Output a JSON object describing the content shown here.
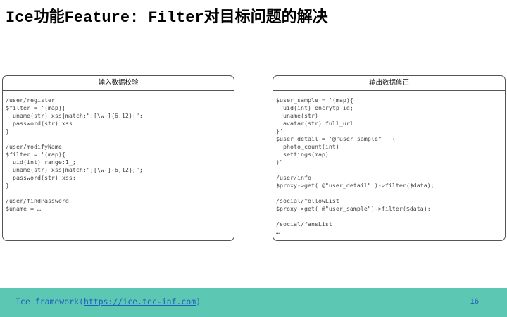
{
  "slide": {
    "title": "Ice功能Feature: Filter对目标问题的解决"
  },
  "left_panel": {
    "header": "输入数据校验",
    "lines": [
      "/user/register",
      "$filter = '(map){",
      "  uname(str) xss|match:\";[\\w-]{6,12};\";",
      "  password(str) xss",
      "}'",
      "",
      "/user/modifyName",
      "$filter = '(map){",
      "  uid(int) range:1_;",
      "  uname(str) xss|match:\";[\\w-]{6,12};\";",
      "  password(str) xss;",
      "}'",
      "",
      "/user/findPassword",
      "$uname = …"
    ]
  },
  "right_panel": {
    "header": "输出数据修正",
    "lines": [
      "$user_sample = '(map){",
      "  uid(int) encrytp_id;",
      "  uname(str);",
      "  avatar(str) full_url",
      "}'",
      "$user_detail = '@\"user_sample\" | (",
      "  photo_count(int)",
      "  settings(map)",
      ")\"",
      "",
      "/user/info",
      "$proxy->get('@\"user_detail\"')->filter($data);",
      "",
      "/social/followList",
      "$proxy->get('@\"user_sample\")->filter($data);",
      "",
      "/social/fansList",
      "…"
    ]
  },
  "footer": {
    "prefix": "Ice framework(",
    "link": "https://ice.tec-inf.com",
    "suffix": ")",
    "page_number": "16"
  }
}
